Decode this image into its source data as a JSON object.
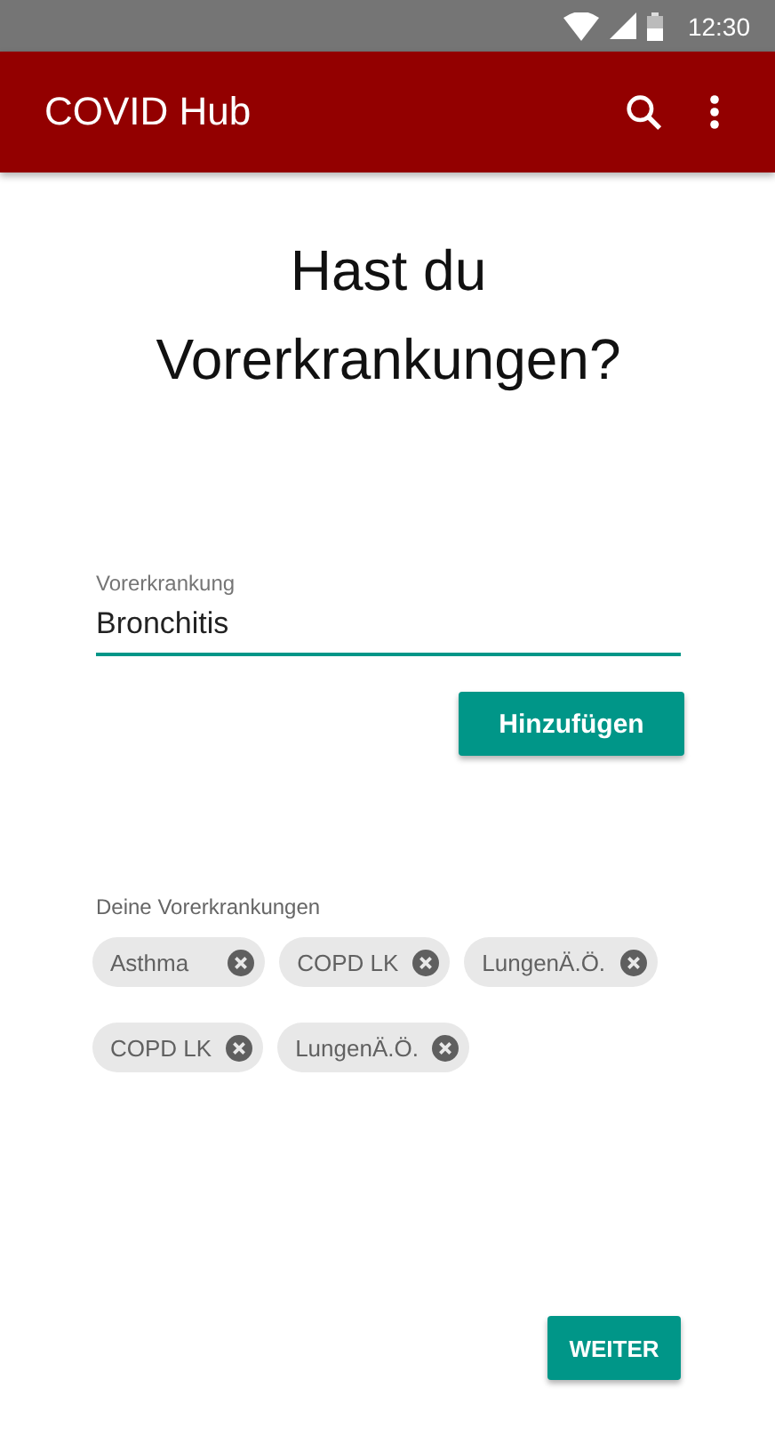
{
  "status_bar": {
    "time": "12:30"
  },
  "app_bar": {
    "title": "COVID Hub"
  },
  "question": "Hast du Vorerkrankungen?",
  "field": {
    "label": "Vorerkrankung",
    "value": "Bronchitis",
    "focused": true
  },
  "add_button": "Hinzufügen",
  "list_label": "Deine Vorerkrankungen",
  "chips": [
    {
      "label": "Asthma"
    },
    {
      "label": "COPD LK"
    },
    {
      "label": "LungenÄ.Ö."
    },
    {
      "label": "COPD LK"
    },
    {
      "label": "LungenÄ.Ö."
    }
  ],
  "next_button": "WEITER"
}
